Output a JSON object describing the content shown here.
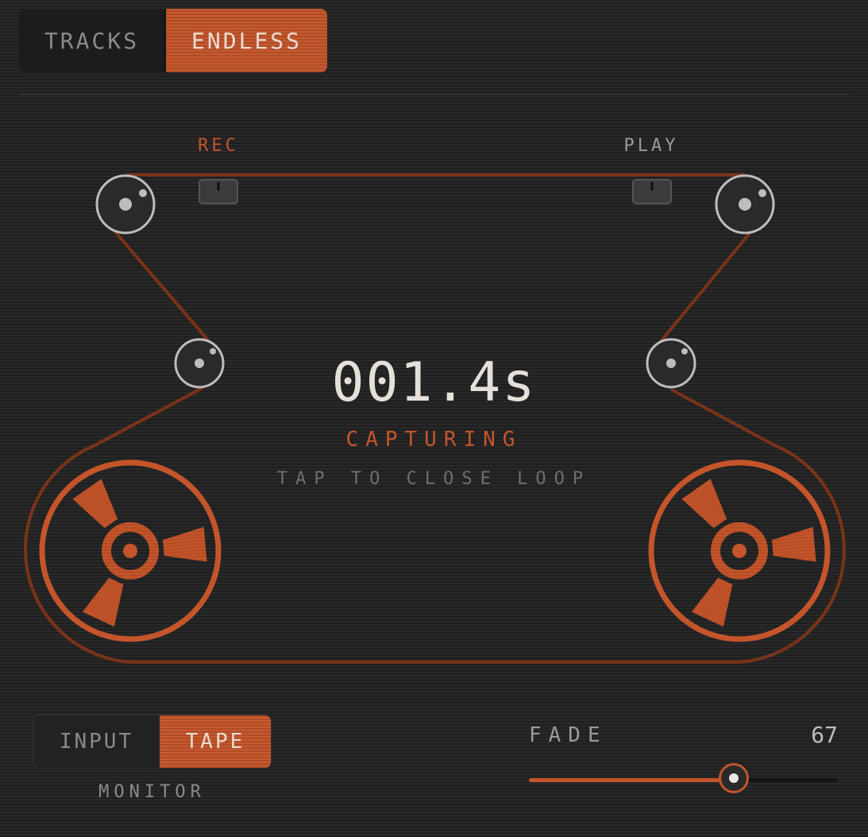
{
  "mode_switch": {
    "options": [
      "TRACKS",
      "ENDLESS"
    ],
    "selected": "ENDLESS"
  },
  "heads": {
    "rec_label": "REC",
    "play_label": "PLAY"
  },
  "display": {
    "time": "001.4s",
    "status": "CAPTURING",
    "hint": "TAP TO CLOSE LOOP"
  },
  "monitor": {
    "options": [
      "INPUT",
      "TAPE"
    ],
    "selected": "TAPE",
    "caption": "MONITOR"
  },
  "fade": {
    "label": "FADE",
    "value": "67",
    "level": 0.67
  },
  "colors": {
    "accent": "#c4552a",
    "tape": "#7a3317",
    "background": "#262626",
    "guide": "#bdbdbd"
  },
  "icons": [
    "reel-icon",
    "guide-roller-icon",
    "tape-head-icon",
    "slider-thumb"
  ]
}
